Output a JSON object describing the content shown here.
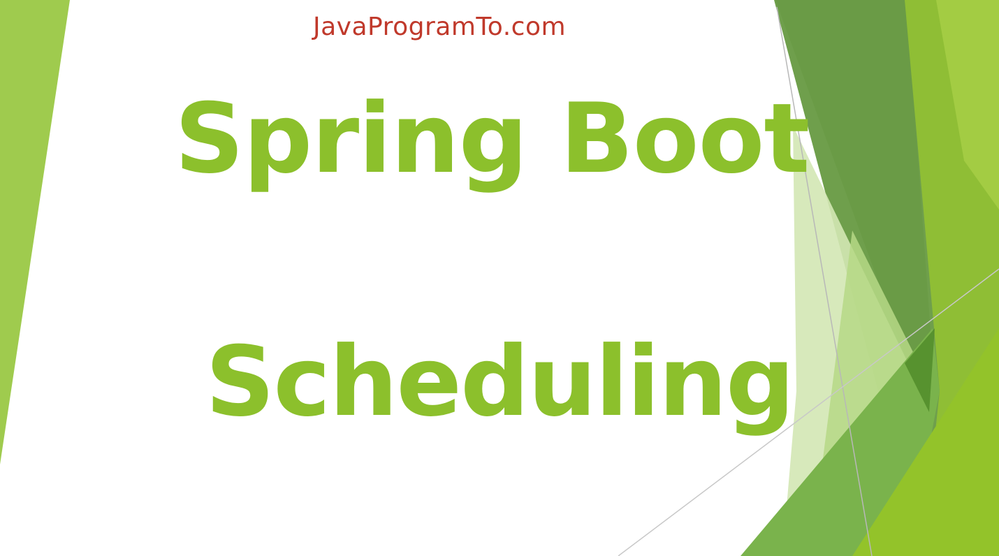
{
  "slide": {
    "site_name": "JavaProgramTo.com",
    "title_line_1": "Spring Boot",
    "title_line_2": "Scheduling"
  },
  "colors": {
    "site_name": "#c0392b",
    "title": "#8cc02c",
    "accent_light": "#a6cd5a",
    "accent_mid": "#79b43a",
    "accent_dark": "#5b8f33",
    "background": "#ffffff"
  }
}
